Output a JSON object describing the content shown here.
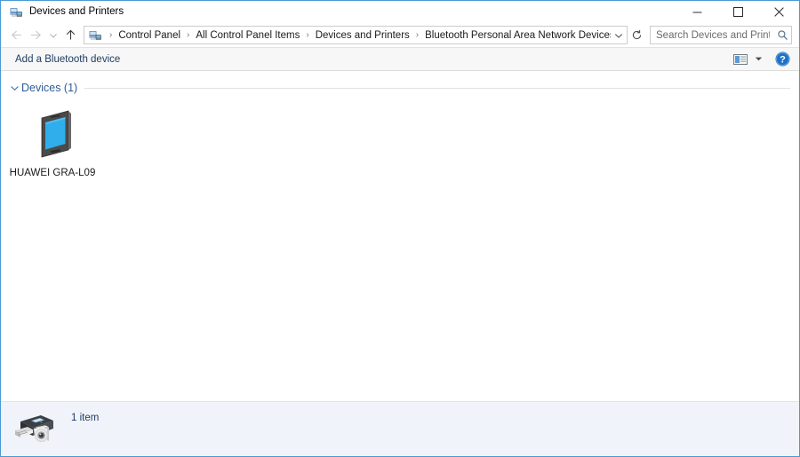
{
  "window": {
    "title": "Devices and Printers",
    "icon": "devices-and-printers-icon",
    "controls": {
      "minimize": "minimize-button",
      "maximize": "maximize-button",
      "close": "close-button"
    }
  },
  "addressbar": {
    "back": "back-button",
    "forward": "forward-button",
    "recent": "recent-locations-button",
    "up": "up-button",
    "path_icon": "devices-and-printers-icon",
    "crumbs": [
      "Control Panel",
      "All Control Panel Items",
      "Devices and Printers",
      "Bluetooth Personal Area Network Devices"
    ],
    "separator": "›",
    "dropdown": "previous-locations-chevron",
    "refresh": "refresh-button"
  },
  "search": {
    "placeholder": "Search Devices and Printers",
    "value": "",
    "icon": "search-icon"
  },
  "commandbar": {
    "add_device_label": "Add a Bluetooth device",
    "view_icon": "change-view-icon",
    "view_dropdown_icon": "chevron-down-icon",
    "help_icon": "help-icon"
  },
  "content": {
    "group": {
      "chevron": "chevron-down-icon",
      "title": "Devices (1)"
    },
    "devices": [
      {
        "label": "HUAWEI GRA-L09",
        "icon": "smartphone-icon"
      }
    ]
  },
  "statusbar": {
    "icon": "printer-camera-icon",
    "text": "1 item"
  },
  "colors": {
    "window_border": "#4a9ad4",
    "accent_link": "#1f3c63",
    "group_title": "#2c5c94",
    "command_bar_bg": "#f7f7f7",
    "status_bar_bg": "#f0f3f9",
    "phone_screen": "#2aa8e8",
    "phone_body": "#4a4a4a",
    "help_blue": "#1f6fc4"
  }
}
